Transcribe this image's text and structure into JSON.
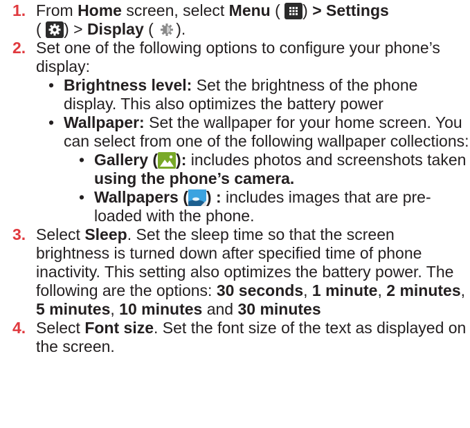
{
  "steps": [
    {
      "num": "1.",
      "t1": "From ",
      "home": "Home",
      "t2": " screen, select ",
      "menu": "Menu",
      "t3": " (",
      "t4": ") ",
      "settings": "> Settings",
      "t5": "(",
      "t6": ") > ",
      "display": "Display",
      "t7": " (",
      "t8": ")."
    },
    {
      "num": "2.",
      "text": "Set one of the following options to configure your phone’s display:"
    },
    {
      "num": "3.",
      "t1": "Select ",
      "sleep": "Sleep",
      "t2": ". Set the sleep time so that the screen brightness is turned down after specified time of phone inactivity. This setting also optimizes the battery power. The following are the options: ",
      "o1": "30 seconds",
      "c1": ", ",
      "o2": "1 minute",
      "c2": ", ",
      "o3": "2 minutes",
      "c3": ", ",
      "o4": "5 minutes",
      "c4": ", ",
      "o5": "10 minutes",
      "c5": " and ",
      "o6": "30 minutes"
    },
    {
      "num": "4.",
      "t1": "Select ",
      "font": "Font size",
      "t2": ". Set the font size of the text as displayed on the screen."
    }
  ],
  "options": [
    {
      "label": "Brightness level:",
      "text": " Set the brightness of the phone display. This also optimizes the battery power"
    },
    {
      "label": "Wallpaper:",
      "text": "  Set the wallpaper for your home screen. You can select from one of the following wallpaper collections:"
    }
  ],
  "collections": [
    {
      "label": "Gallery (",
      "label_end": "):",
      "text1": " includes photos and screenshots taken ",
      "text2": "using the phone’s camera."
    },
    {
      "label": "Wallpapers (",
      "label_end": ") :",
      "text1": " includes images that are pre-loaded with the phone."
    }
  ],
  "bullet": "•",
  "icons": [
    "menu-grid-icon",
    "settings-gear-icon",
    "display-brightness-icon",
    "gallery-icon",
    "wallpapers-icon"
  ],
  "colors": {
    "step_number": "#e0393e",
    "text": "#231f20",
    "gallery": "#79a928",
    "wallpapers": "#2f9ad8"
  }
}
